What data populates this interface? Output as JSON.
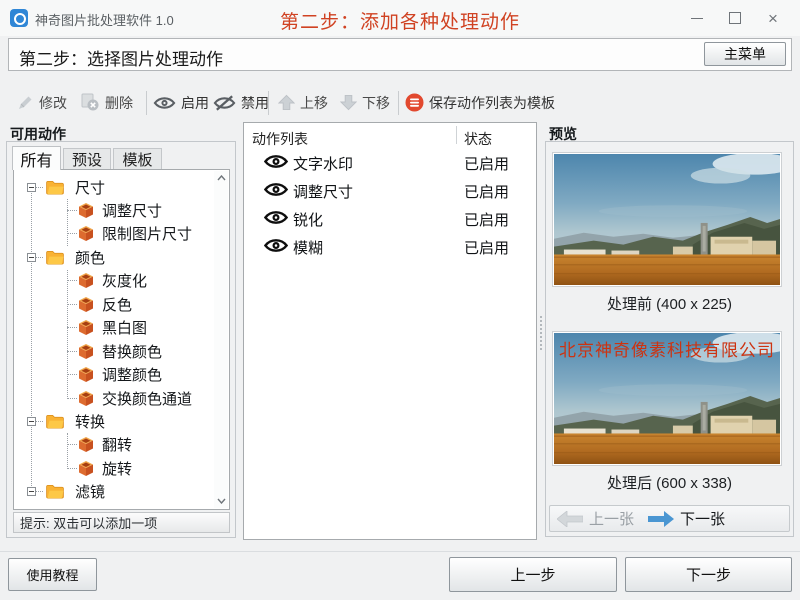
{
  "window": {
    "title": "神奇图片批处理软件 1.0",
    "step_title": "第二步：添加各种处理动作"
  },
  "header": {
    "subtitle": "第二步：选择图片处理动作",
    "main_menu": "主菜单"
  },
  "toolbar": {
    "modify": "修改",
    "delete": "删除",
    "enable": "启用",
    "disable": "禁用",
    "move_up": "上移",
    "move_down": "下移",
    "save_template": "保存动作列表为模板"
  },
  "left_panel": {
    "title": "可用动作",
    "tabs": [
      "所有",
      "预设",
      "模板"
    ],
    "tree": [
      "尺寸",
      "调整尺寸",
      "限制图片尺寸",
      "颜色",
      "灰度化",
      "反色",
      "黑白图",
      "替换颜色",
      "调整颜色",
      "交换颜色通道",
      "转换",
      "翻转",
      "旋转",
      "滤镜"
    ],
    "hint": "提示: 双击可以添加一项"
  },
  "action_list": {
    "title": "动作列表",
    "status_header": "状态",
    "rows": [
      {
        "name": "文字水印",
        "status": "已启用"
      },
      {
        "name": "调整尺寸",
        "status": "已启用"
      },
      {
        "name": "锐化",
        "status": "已启用"
      },
      {
        "name": "模糊",
        "status": "已启用"
      }
    ]
  },
  "preview": {
    "title": "预览",
    "before_caption": "处理前 (400 x 225)",
    "after_caption": "处理后 (600 x 338)",
    "watermark": "北京神奇像素科技有限公司",
    "prev_label": "上一张",
    "next_label": "下一张"
  },
  "footer": {
    "tutorial": "使用教程",
    "back": "上一步",
    "next": "下一步"
  },
  "colors": {
    "step_title_red": "#d04222",
    "save_icon_red": "#e2492f",
    "next_arrow_blue": "#4a96d2",
    "folder_yellow": "#f9b233",
    "box_orange": "#dd6b2f",
    "watermark_red": "#cc3311"
  }
}
